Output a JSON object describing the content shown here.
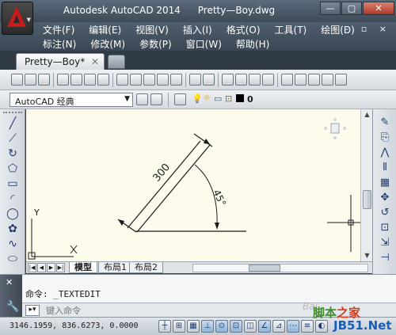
{
  "titlebar": {
    "app_name": "Autodesk AutoCAD 2014",
    "file_name": "Pretty—Boy.dwg",
    "minimize": "—",
    "restore": "▢",
    "close": "✕"
  },
  "menus": {
    "row1": [
      "文件(F)",
      "编辑(E)",
      "视图(V)",
      "插入(I)",
      "格式(O)",
      "工具(T)",
      "绘图(D)"
    ],
    "row2": [
      "标注(N)",
      "修改(M)",
      "参数(P)",
      "窗口(W)",
      "帮助(H)"
    ],
    "mdi_controls": "– ▫ ×"
  },
  "tabs": {
    "document_tab": "Pretty—Boy*",
    "close_glyph": "✕"
  },
  "toolbar": {
    "workspace": "AutoCAD 经典",
    "layer_value": "0"
  },
  "drawing": {
    "dimension_length": "300",
    "angle_dimension": "45°",
    "ucs_y": "Y",
    "ucs_x": "X"
  },
  "layout_tabs": [
    "模型",
    "布局1",
    "布局2"
  ],
  "command": {
    "history": "命令:  _TEXTEDIT",
    "placeholder": "键入命令"
  },
  "status": {
    "coordinates": "3146.1959, 836.6273, 0.0000"
  },
  "watermark": {
    "baidu": "Bai",
    "site_a": "脚本",
    "site_b": "之家",
    "site_url": "JB51.Net"
  },
  "colors": {
    "canvas_bg": "#fdfbec",
    "accent_red": "#c41c1c"
  }
}
